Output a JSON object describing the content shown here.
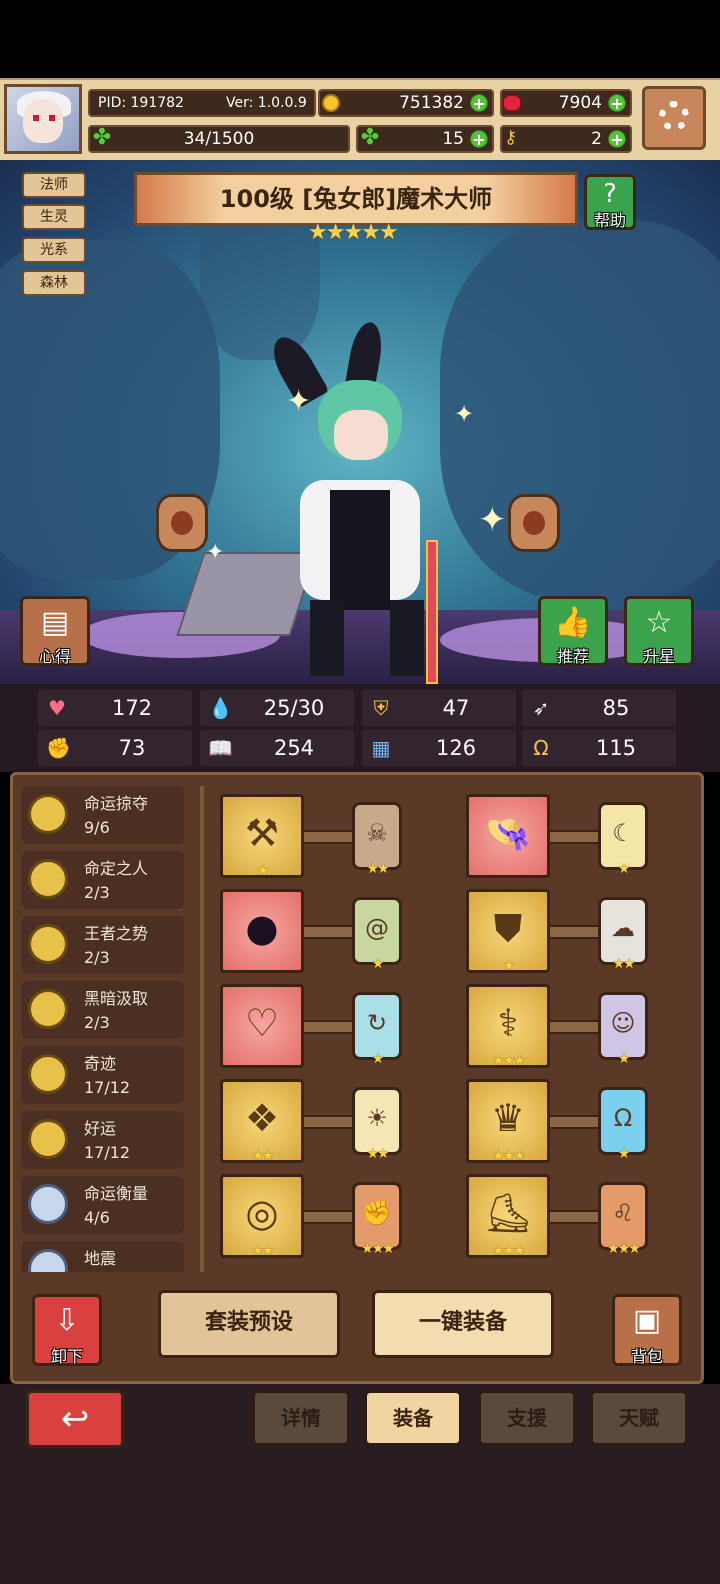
{
  "header": {
    "pid": "PID: 191782",
    "version": "Ver: 1.0.0.9",
    "gold": "751382",
    "ruby": "7904",
    "stamina": "34/1500",
    "clover": "15",
    "keys": "2"
  },
  "hero": {
    "tags": [
      "法师",
      "生灵",
      "光系",
      "森林"
    ],
    "title": "100级 [兔女郎]魔术大师",
    "stars": "★★★★★",
    "help_label": "帮助",
    "notes_label": "心得",
    "recommend_label": "推荐",
    "starup_label": "升星"
  },
  "stats": [
    {
      "icon": "heart-icon",
      "value": "172"
    },
    {
      "icon": "drop-icon",
      "value": "25/30"
    },
    {
      "icon": "shield-icon",
      "value": "47"
    },
    {
      "icon": "wing-icon",
      "value": "85"
    },
    {
      "icon": "fist-icon",
      "value": "73"
    },
    {
      "icon": "book-icon",
      "value": "254"
    },
    {
      "icon": "scroll-icon",
      "value": "126"
    },
    {
      "icon": "horseshoe-icon",
      "value": "115"
    }
  ],
  "sets": [
    {
      "name": "命运掠夺",
      "count": "9/6"
    },
    {
      "name": "命定之人",
      "count": "2/3"
    },
    {
      "name": "王者之势",
      "count": "2/3"
    },
    {
      "name": "黑暗汲取",
      "count": "2/3"
    },
    {
      "name": "奇迹",
      "count": "17/12"
    },
    {
      "name": "好运",
      "count": "17/12"
    },
    {
      "name": "命运衡量",
      "count": "4/6"
    },
    {
      "name": "地震",
      "count": ""
    }
  ],
  "equipment": [
    {
      "slot": "axe-icon",
      "slot_bg": "gold",
      "slot_stars": "★",
      "card": "skull-card-icon",
      "card_bg": "#c9a98c",
      "card_stars": "★★"
    },
    {
      "slot": "hat-icon",
      "slot_bg": "pink",
      "slot_stars": "",
      "card": "moon-card-icon",
      "card_bg": "#f4e6a8",
      "card_stars": "★"
    },
    {
      "slot": "dark-orb-icon",
      "slot_bg": "pink",
      "slot_stars": "",
      "card": "spiral-card-icon",
      "card_bg": "#c8d6a0",
      "card_stars": "★"
    },
    {
      "slot": "armor-icon",
      "slot_bg": "gold",
      "slot_stars": "★",
      "card": "ghost-card-icon",
      "card_bg": "#e6e2dc",
      "card_stars": "★★"
    },
    {
      "slot": "necklace-icon",
      "slot_bg": "pink",
      "slot_stars": "",
      "card": "swirl-card-icon",
      "card_bg": "#a9e0e8",
      "card_stars": "★"
    },
    {
      "slot": "scepter-icon",
      "slot_bg": "gold",
      "slot_stars": "★★★",
      "card": "face-card-icon",
      "card_bg": "#cfc6e6",
      "card_stars": "★"
    },
    {
      "slot": "gem-frame-icon",
      "slot_bg": "gold",
      "slot_stars": "★★",
      "card": "sun-card-icon",
      "card_bg": "#f6e6b6",
      "card_stars": "★★"
    },
    {
      "slot": "ring-crown-icon",
      "slot_bg": "gold",
      "slot_stars": "★★★",
      "card": "horseshoe-card-icon",
      "card_bg": "#7ad0ee",
      "card_stars": "★"
    },
    {
      "slot": "ring-icon",
      "slot_bg": "gold",
      "slot_stars": "★★",
      "card": "fist-card-icon",
      "card_bg": "#e59a6a",
      "card_stars": "★★★"
    },
    {
      "slot": "boots-icon",
      "slot_bg": "gold",
      "slot_stars": "★★★",
      "card": "lion-card-icon",
      "card_bg": "#e59a6a",
      "card_stars": "★★★"
    }
  ],
  "actions": {
    "unequip_label": "卸下",
    "preset_label": "套装预设",
    "oneclick_label": "一键装备",
    "bag_label": "背包"
  },
  "tabs": [
    {
      "label": "详情",
      "active": false
    },
    {
      "label": "装备",
      "active": true
    },
    {
      "label": "支援",
      "active": false
    },
    {
      "label": "天赋",
      "active": false
    }
  ],
  "colors": {
    "gold_slot": "#e2b34e",
    "pink_slot": "#ec8a85",
    "panel": "#5a3a26",
    "accent_green": "#3aa34b",
    "accent_red": "#d8413f"
  }
}
